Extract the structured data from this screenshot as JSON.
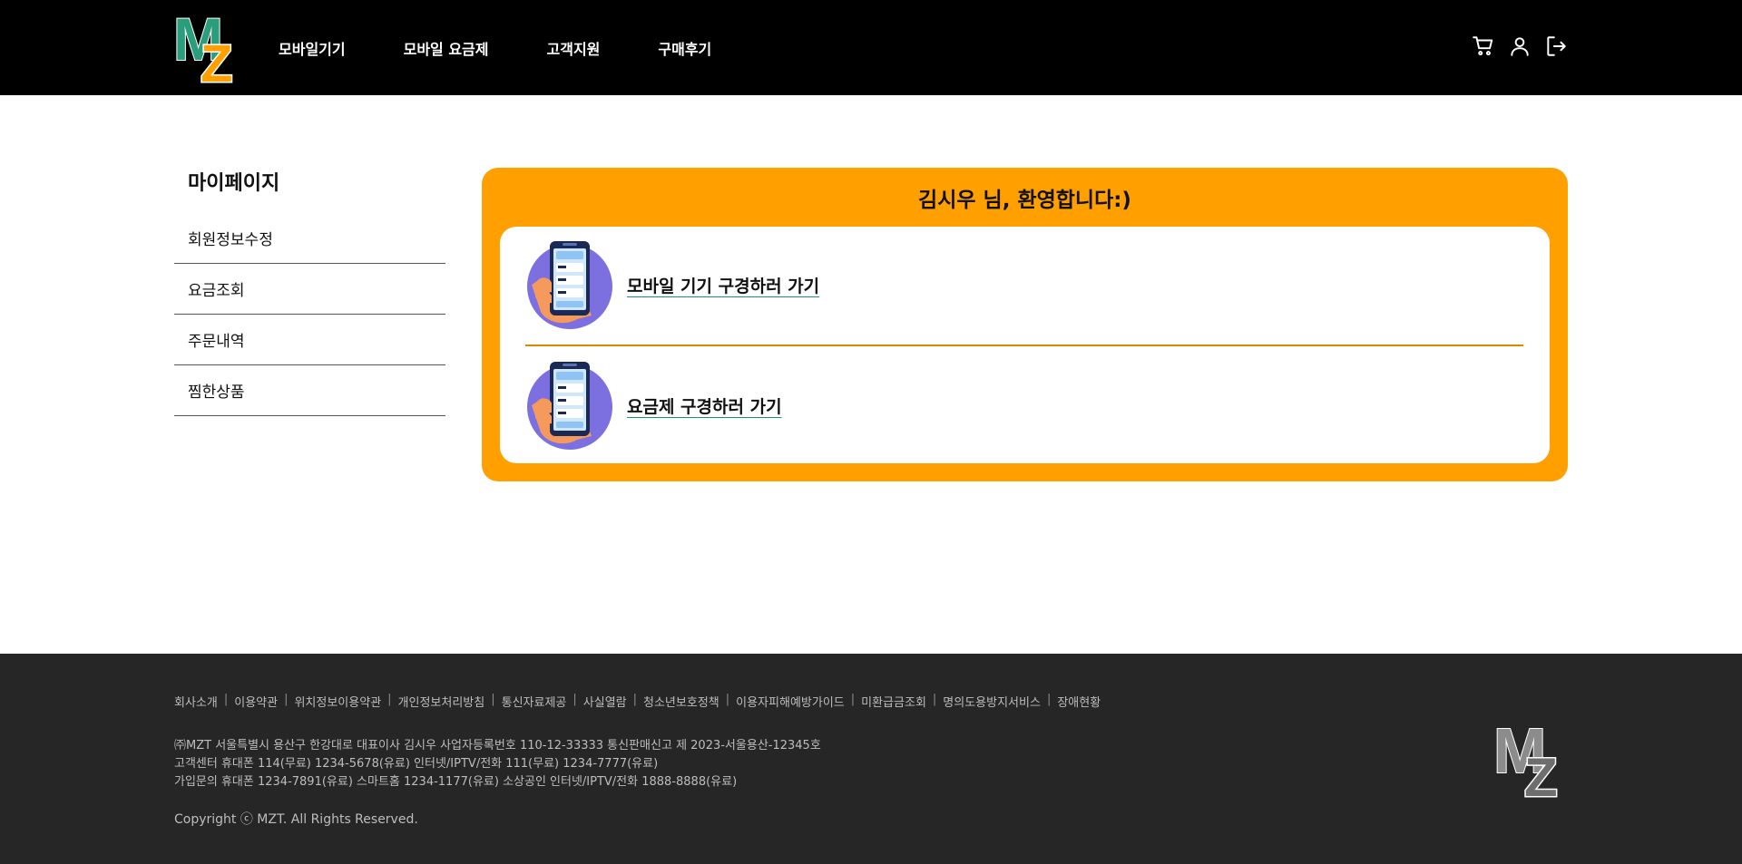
{
  "header": {
    "logo_text": "MZ",
    "nav": [
      "모바일기기",
      "모바일 요금제",
      "고객지원",
      "구매후기"
    ],
    "icons": [
      "cart-icon",
      "user-icon",
      "logout-icon"
    ]
  },
  "sidebar": {
    "title": "마이페이지",
    "items": [
      "회원정보수정",
      "요금조회",
      "주문내역",
      "찜한상품"
    ]
  },
  "main": {
    "welcome": "김시우 님, 환영합니다:)",
    "links": [
      "모바일 기기 구경하러 가기",
      "요금제 구경하러 가기"
    ]
  },
  "footer": {
    "links": [
      "회사소개",
      "이용약관",
      "위치정보이용약관",
      "개인정보처리방침",
      "통신자료제공",
      "사실열람",
      "청소년보호정책",
      "이용자피해예방가이드",
      "미환급금조회",
      "명의도용방지서비스",
      "장애현황"
    ],
    "info": [
      "㈜MZT 서울특별시 용산구 한강대로 대표이사 김시우 사업자등록번호 110-12-33333 통신판매신고 제 2023-서울용산-12345호",
      "고객센터 휴대폰 114(무료) 1234-5678(유료) 인터넷/IPTV/전화 111(무료) 1234-7777(유료)",
      "가입문의 휴대폰 1234-7891(유료) 스마트홈 1234-1177(유료) 소상공인 인터넷/IPTV/전화 1888-8888(유료)"
    ],
    "copyright": "Copyright ⓒ MZT. All Rights Reserved."
  },
  "colors": {
    "accent": "#ff9f00",
    "logo_green": "#2a9d7c",
    "header_bg": "#000000",
    "footer_bg": "#262626"
  }
}
